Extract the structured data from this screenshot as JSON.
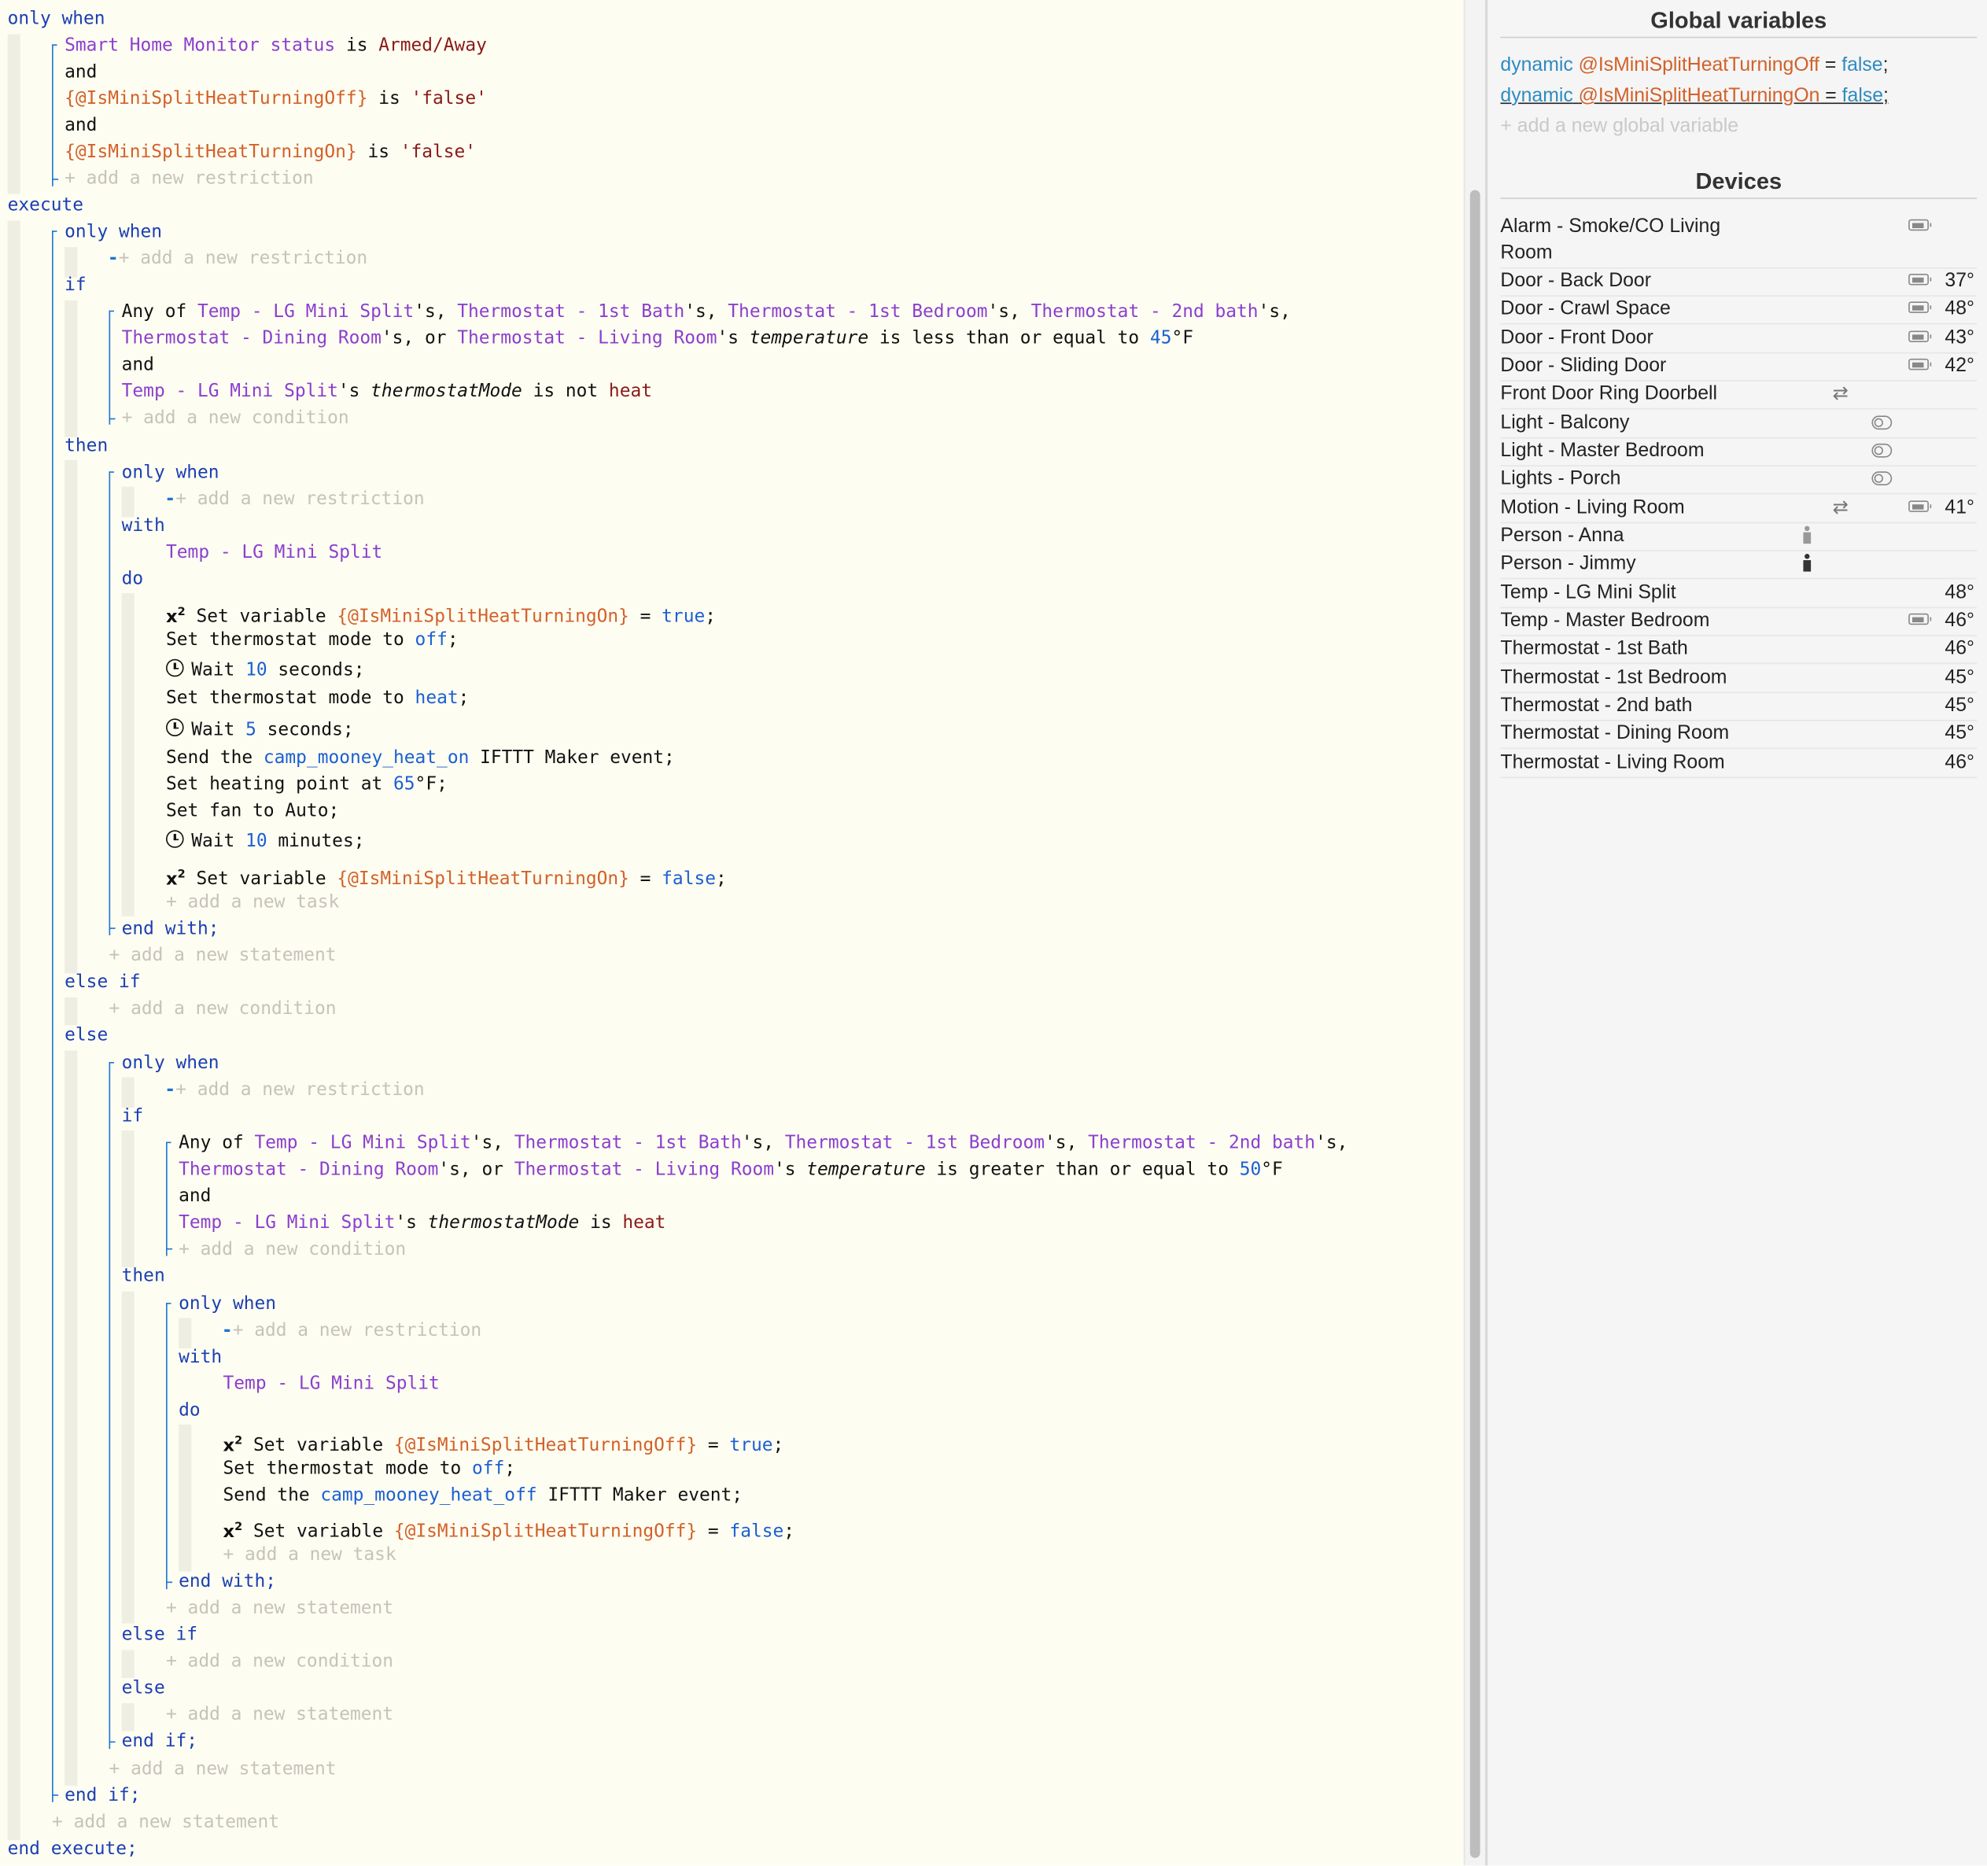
{
  "editor": {
    "kw_only_when": "only when",
    "kw_and": "and",
    "kw_execute": "execute",
    "kw_if": "if",
    "kw_then": "then",
    "kw_with": "with",
    "kw_do": "do",
    "kw_end_with": "end with;",
    "kw_else_if": "else if",
    "kw_else": "else",
    "kw_end_if": "end if;",
    "kw_end_execute": "end execute;",
    "add_restriction": "+ add a new restriction",
    "add_condition": "+ add a new condition",
    "add_statement": "+ add a new statement",
    "add_task": "+ add a new task",
    "top_restrictions": {
      "r1_device": "Smart Home Monitor status",
      "r1_is": " is ",
      "r1_value": "Armed/Away",
      "r2_var": "{@IsMiniSplitHeatTurningOff}",
      "r2_is": " is ",
      "r2_value": "'false'",
      "r3_var": "{@IsMiniSplitHeatTurningOn}",
      "r3_is": " is ",
      "r3_value": "'false'"
    },
    "cond1": {
      "any_of": "Any of ",
      "d1": "Temp - LG Mini Split",
      "d2": "Thermostat - 1st Bath",
      "d3": "Thermostat - 1st Bedroom",
      "d4": "Thermostat - 2nd bath",
      "d5": "Thermostat - Dining Room",
      "d6": "Thermostat - Living Room",
      "poss": "'s, ",
      "poss_or": "'s, or ",
      "poss_last": "'s, ",
      "poss_end": "'s ",
      "attr": "temperature",
      "op": " is less than or equal to ",
      "num": "45",
      "unit": "°F",
      "mode_device": "Temp - LG Mini Split",
      "mode_poss": "'s ",
      "mode_attr": "thermostatMode",
      "mode_op": " is not ",
      "mode_value": "heat"
    },
    "block1": {
      "with_device": "Temp - LG Mini Split",
      "t1_pre": "Set variable ",
      "t1_var": "{@IsMiniSplitHeatTurningOn}",
      "t1_eq": " = ",
      "t1_val": "true",
      "semi": ";",
      "t2_pre": "Set thermostat mode to ",
      "t2_val": "off",
      "t3_pre": "Wait ",
      "t3_num": "10",
      "t3_post": " seconds;",
      "t4_pre": "Set thermostat mode to ",
      "t4_val": "heat",
      "t5_pre": "Wait ",
      "t5_num": "5",
      "t5_post": " seconds;",
      "t6_pre": "Send the ",
      "t6_val": "camp_mooney_heat_on",
      "t6_post": " IFTTT Maker event;",
      "t7_pre": "Set heating point at ",
      "t7_num": "65",
      "t7_post": "°F;",
      "t8": "Set fan to Auto;",
      "t9_pre": "Wait ",
      "t9_num": "10",
      "t9_post": " minutes;",
      "t10_pre": "Set variable ",
      "t10_var": "{@IsMiniSplitHeatTurningOn}",
      "t10_eq": " = ",
      "t10_val": "false"
    },
    "cond2": {
      "any_of": "Any of ",
      "d1": "Temp - LG Mini Split",
      "d2": "Thermostat - 1st Bath",
      "d3": "Thermostat - 1st Bedroom",
      "d4": "Thermostat - 2nd bath",
      "d5": "Thermostat - Dining Room",
      "d6": "Thermostat - Living Room",
      "poss": "'s, ",
      "poss_or": "'s, or ",
      "poss_last": "'s, ",
      "poss_end": "'s ",
      "attr": "temperature",
      "op": " is greater than or equal to ",
      "num": "50",
      "unit": "°F",
      "mode_device": "Temp - LG Mini Split",
      "mode_poss": "'s ",
      "mode_attr": "thermostatMode",
      "mode_op": " is ",
      "mode_value": "heat"
    },
    "block2": {
      "with_device": "Temp - LG Mini Split",
      "t1_pre": "Set variable ",
      "t1_var": "{@IsMiniSplitHeatTurningOff}",
      "t1_eq": " = ",
      "t1_val": "true",
      "t2_pre": "Set thermostat mode to ",
      "t2_val": "off",
      "t3_pre": "Send the ",
      "t3_val": "camp_mooney_heat_off",
      "t3_post": " IFTTT Maker event;",
      "t4_pre": "Set variable ",
      "t4_var": "{@IsMiniSplitHeatTurningOff}",
      "t4_eq": " = ",
      "t4_val": "false"
    }
  },
  "panel": {
    "globals_title": "Global variables",
    "globals": [
      {
        "kw": "dynamic",
        "name": "@IsMiniSplitHeatTurningOff",
        "eq": " = ",
        "value": "false",
        "semi": ";"
      },
      {
        "kw": "dynamic",
        "name": "@IsMiniSplitHeatTurningOn",
        "eq": " = ",
        "value": "false",
        "semi": ";"
      }
    ],
    "add_global": "+ add a new global variable",
    "devices_title": "Devices",
    "devices": [
      {
        "name": "Alarm - Smoke/CO Living",
        "name2": "Room",
        "icon": "battery-icon",
        "temp": ""
      },
      {
        "name": "Door - Back Door",
        "icon": "battery-icon",
        "temp": "37°"
      },
      {
        "name": "Door - Crawl Space",
        "icon": "battery-icon",
        "temp": "48°"
      },
      {
        "name": "Door - Front Door",
        "icon": "battery-icon",
        "temp": "43°"
      },
      {
        "name": "Door - Sliding Door",
        "icon": "battery-icon",
        "temp": "42°"
      },
      {
        "name": "Front Door Ring Doorbell",
        "icon": "swap-icon",
        "temp": ""
      },
      {
        "name": "Light - Balcony",
        "icon": "toggle-icon",
        "temp": ""
      },
      {
        "name": "Light - Master Bedroom",
        "icon": "toggle-icon",
        "temp": ""
      },
      {
        "name": "Lights - Porch",
        "icon": "toggle-icon",
        "temp": ""
      },
      {
        "name": "Motion - Living Room",
        "icon": "swap-icon",
        "icon2": "battery-icon",
        "temp": "41°"
      },
      {
        "name": "Person - Anna",
        "icon": "person-away-icon",
        "temp": ""
      },
      {
        "name": "Person - Jimmy",
        "icon": "person-present-icon",
        "temp": ""
      },
      {
        "name": "Temp - LG Mini Split",
        "icon": "",
        "temp": "48°"
      },
      {
        "name": "Temp - Master Bedroom",
        "icon": "battery-icon",
        "temp": "46°"
      },
      {
        "name": "Thermostat - 1st Bath",
        "icon": "",
        "temp": "46°"
      },
      {
        "name": "Thermostat - 1st Bedroom",
        "icon": "",
        "temp": "45°"
      },
      {
        "name": "Thermostat - 2nd bath",
        "icon": "",
        "temp": "45°"
      },
      {
        "name": "Thermostat - Dining Room",
        "icon": "",
        "temp": "45°"
      },
      {
        "name": "Thermostat - Living Room",
        "icon": "",
        "temp": "46°"
      }
    ]
  }
}
